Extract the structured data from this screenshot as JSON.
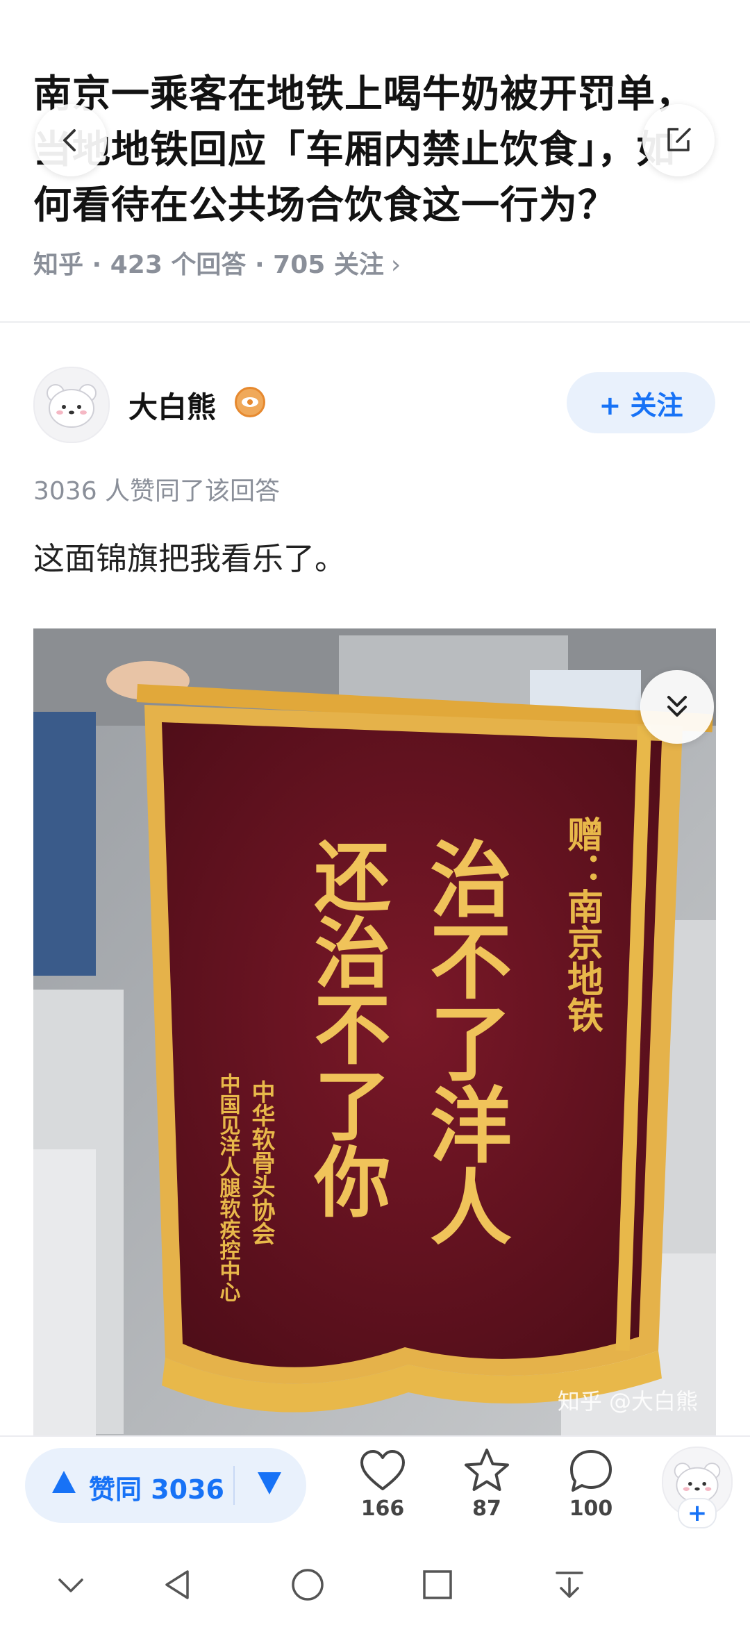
{
  "question": {
    "title": "南京一乘客在地铁上喝牛奶被开罚单，当地地铁回应「车厢内禁止饮食」，如何看待在公共场合饮食这一行为？",
    "meta": "知乎 · 423 个回答 · 705 关注",
    "meta_chevron": "›"
  },
  "header_buttons": {
    "back_icon": "back-chevron-icon",
    "share_icon": "share-edit-icon"
  },
  "author": {
    "name": "大白熊",
    "badge_icon": "eye-badge-icon",
    "follow_label": "+ 关注"
  },
  "answer": {
    "votes_line": "3036 人赞同了该回答",
    "text": "这面锦旗把我看乐了。"
  },
  "banner": {
    "line_gift": "赠：南京地铁",
    "line1": "治不了洋人",
    "line2": "还治不了你",
    "org1": "中华软骨头协会",
    "org2": "中国见洋人腿软疾控中心",
    "watermark": "知乎 @大白熊"
  },
  "action_bar": {
    "vote_label": "赞同 3036",
    "like_count": "166",
    "star_count": "87",
    "comment_count": "100",
    "fav_plus": "+"
  },
  "colors": {
    "accent": "#1772f6",
    "pill_bg": "#e9f1fc",
    "banner_red": "#6e1422",
    "gold": "#e8b84a"
  }
}
